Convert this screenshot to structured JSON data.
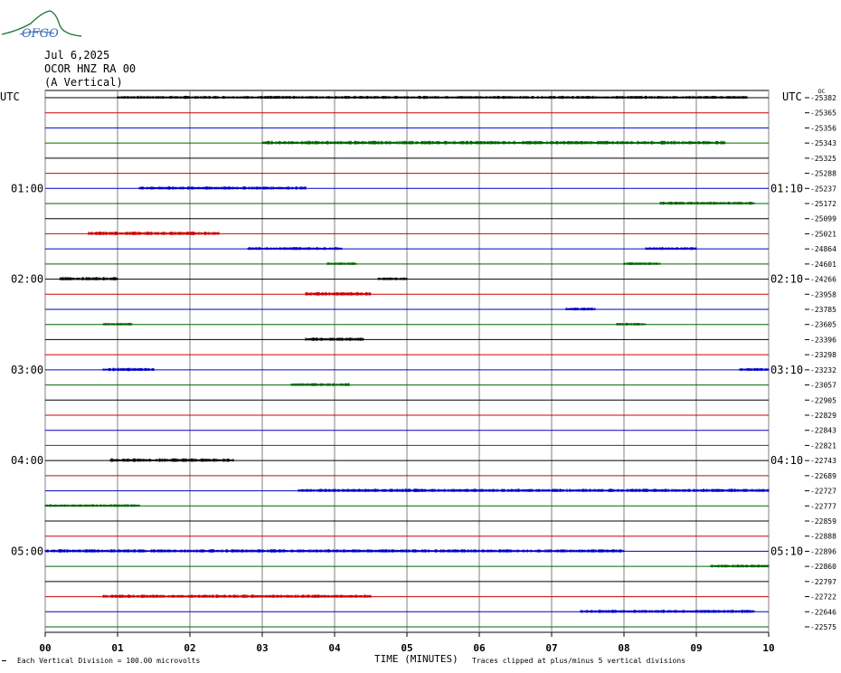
{
  "logo": {
    "text": "OFGO"
  },
  "header": {
    "date": "Jul 6,2025",
    "station": "OCOR HNZ RA 00",
    "component": "(A Vertical)"
  },
  "utc_label_left": "UTC",
  "utc_label_right": "UTC",
  "top_right_tag": "DC",
  "colors": {
    "black": "#000000",
    "red": "#d00000",
    "blue": "#0000cc",
    "green": "#006600",
    "grid": "#808080"
  },
  "chart_data": {
    "type": "line",
    "title": "",
    "xlabel": "TIME (MINUTES)",
    "ylabel": "",
    "xlim": [
      0,
      10
    ],
    "x_ticks": [
      "00",
      "01",
      "02",
      "03",
      "04",
      "05",
      "06",
      "07",
      "08",
      "09",
      "10"
    ],
    "grid": true,
    "trace_color_cycle": [
      "black",
      "red",
      "blue",
      "green"
    ],
    "left_time_labels": [
      {
        "row": 6,
        "label": "01:00"
      },
      {
        "row": 12,
        "label": "02:00"
      },
      {
        "row": 18,
        "label": "03:00"
      },
      {
        "row": 24,
        "label": "04:00"
      },
      {
        "row": 30,
        "label": "05:00"
      }
    ],
    "right_time_labels": [
      {
        "row": 6,
        "label": "01:10"
      },
      {
        "row": 12,
        "label": "02:10"
      },
      {
        "row": 18,
        "label": "03:10"
      },
      {
        "row": 24,
        "label": "04:10"
      },
      {
        "row": 30,
        "label": "05:10"
      }
    ],
    "row_offsets": [
      "-25382",
      "-25365",
      "-25356",
      "-25343",
      "-25325",
      "-25288",
      "-25237",
      "-25172",
      "-25099",
      "-25021",
      "-24864",
      "-24601",
      "-24266",
      "-23958",
      "-23785",
      "-23605",
      "-23396",
      "-23298",
      "-23232",
      "-23057",
      "-22905",
      "-22829",
      "-22843",
      "-22821",
      "-22743",
      "-22689",
      "-22727",
      "-22777",
      "-22859",
      "-22888",
      "-22896",
      "-22860",
      "-22797",
      "-22722",
      "-22646",
      "-22575"
    ],
    "activity": [
      {
        "row": 0,
        "from": 1.0,
        "to": 9.7,
        "level": 0.5
      },
      {
        "row": 3,
        "from": 3.0,
        "to": 9.4,
        "level": 0.7
      },
      {
        "row": 6,
        "from": 1.3,
        "to": 3.6,
        "level": 0.6
      },
      {
        "row": 7,
        "from": 8.5,
        "to": 9.8,
        "level": 0.5
      },
      {
        "row": 9,
        "from": 0.6,
        "to": 2.4,
        "level": 0.7
      },
      {
        "row": 10,
        "from": 2.8,
        "to": 4.1,
        "level": 0.5
      },
      {
        "row": 10,
        "from": 8.3,
        "to": 9.0,
        "level": 0.5
      },
      {
        "row": 11,
        "from": 3.9,
        "to": 4.3,
        "level": 0.4
      },
      {
        "row": 11,
        "from": 8.0,
        "to": 8.5,
        "level": 0.4
      },
      {
        "row": 12,
        "from": 0.2,
        "to": 1.0,
        "level": 0.6
      },
      {
        "row": 12,
        "from": 4.6,
        "to": 5.0,
        "level": 0.4
      },
      {
        "row": 13,
        "from": 3.6,
        "to": 4.5,
        "level": 0.7
      },
      {
        "row": 14,
        "from": 7.2,
        "to": 7.6,
        "level": 0.5
      },
      {
        "row": 15,
        "from": 0.8,
        "to": 1.2,
        "level": 0.4
      },
      {
        "row": 15,
        "from": 7.9,
        "to": 8.3,
        "level": 0.4
      },
      {
        "row": 16,
        "from": 3.6,
        "to": 4.4,
        "level": 0.6
      },
      {
        "row": 18,
        "from": 0.8,
        "to": 1.5,
        "level": 0.6
      },
      {
        "row": 18,
        "from": 9.6,
        "to": 10.0,
        "level": 0.5
      },
      {
        "row": 19,
        "from": 3.4,
        "to": 4.2,
        "level": 0.5
      },
      {
        "row": 24,
        "from": 0.9,
        "to": 2.6,
        "level": 0.7
      },
      {
        "row": 26,
        "from": 3.5,
        "to": 10.0,
        "level": 0.6
      },
      {
        "row": 27,
        "from": 0.0,
        "to": 1.3,
        "level": 0.4
      },
      {
        "row": 30,
        "from": 0.0,
        "to": 8.0,
        "level": 0.6
      },
      {
        "row": 31,
        "from": 9.2,
        "to": 10.0,
        "level": 0.5
      },
      {
        "row": 33,
        "from": 0.8,
        "to": 4.5,
        "level": 0.6
      },
      {
        "row": 34,
        "from": 7.4,
        "to": 9.8,
        "level": 0.6
      }
    ]
  },
  "footer": {
    "scale_note": "Each Vertical Division =  100.00 microvolts",
    "xaxis_title": "TIME (MINUTES)",
    "clip_note": "Traces clipped at plus/minus 5 vertical divisions"
  }
}
